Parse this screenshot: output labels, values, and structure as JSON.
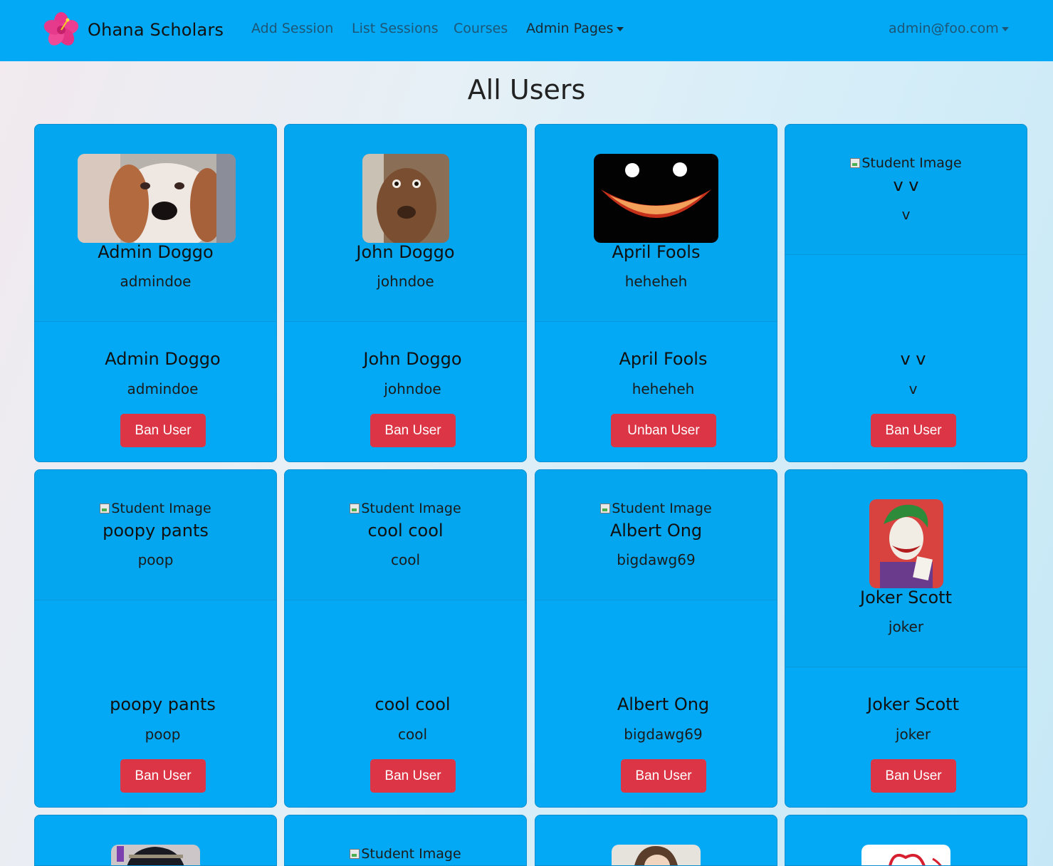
{
  "nav": {
    "brand": "Ohana Scholars",
    "links": [
      "Add Session",
      "List Sessions",
      "Courses"
    ],
    "admin_menu": "Admin Pages",
    "user_menu": "admin@foo.com"
  },
  "page": {
    "title": "All Users"
  },
  "img_alt": "Student Image",
  "users": [
    {
      "name": "Admin Doggo",
      "username": "admindoe",
      "action": "Ban User"
    },
    {
      "name": "John Doggo",
      "username": "johndoe",
      "action": "Ban User"
    },
    {
      "name": "April Fools",
      "username": "heheheh",
      "action": "Unban User"
    },
    {
      "name": "v v",
      "username": "v",
      "action": "Ban User"
    },
    {
      "name": "poopy pants",
      "username": "poop",
      "action": "Ban User"
    },
    {
      "name": "cool cool",
      "username": "cool",
      "action": "Ban User"
    },
    {
      "name": "Albert Ong",
      "username": "bigdawg69",
      "action": "Ban User"
    },
    {
      "name": "Joker Scott",
      "username": "joker",
      "action": "Ban User"
    }
  ],
  "colors": {
    "navbar": "#03a9f4",
    "card": "#03a9f4",
    "danger": "#dc3545"
  }
}
